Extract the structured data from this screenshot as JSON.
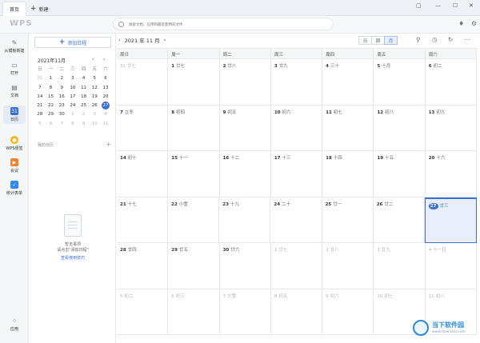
{
  "tabs": {
    "home": "首页",
    "new": "新建"
  },
  "header": {
    "logo": "WPS",
    "search_placeholder": "搜索文档、应用和最近使用的文件"
  },
  "leftnav": [
    {
      "label": "从模板新建",
      "icon": "new-doc-icon"
    },
    {
      "label": "打开",
      "icon": "folder-icon"
    },
    {
      "label": "文档",
      "icon": "document-icon"
    },
    {
      "label": "日历",
      "icon": "calendar-icon",
      "glyph": "31"
    },
    {
      "label": "WPS便签",
      "icon": "sticky-note-icon"
    },
    {
      "label": "会议",
      "icon": "meeting-icon"
    },
    {
      "label": "统计表单",
      "icon": "form-icon"
    },
    {
      "label": "应用",
      "icon": "apps-icon"
    }
  ],
  "side": {
    "add_label": "添加日程",
    "mini_title": "2021年11月",
    "weekdays": [
      "日",
      "一",
      "二",
      "三",
      "四",
      "五",
      "六"
    ],
    "weeks": [
      [
        "31",
        "1",
        "2",
        "3",
        "4",
        "5",
        "6"
      ],
      [
        "7",
        "8",
        "9",
        "10",
        "11",
        "12",
        "13"
      ],
      [
        "14",
        "15",
        "16",
        "17",
        "18",
        "19",
        "20"
      ],
      [
        "21",
        "22",
        "23",
        "24",
        "25",
        "26",
        "27"
      ],
      [
        "28",
        "29",
        "30",
        "1",
        "2",
        "3",
        "4"
      ],
      [
        "5",
        "6",
        "7",
        "8",
        "9",
        "10",
        "11"
      ]
    ],
    "my_calendars": "我的日历",
    "empty_title": "暂无事项",
    "empty_hint": "请点击\"添加日程\"",
    "empty_link": "查看使用技巧"
  },
  "toolbar": {
    "title": "2021 年 11 月",
    "prev": "‹",
    "next": "›",
    "views": [
      "日",
      "周",
      "月"
    ],
    "active_view": "月"
  },
  "calendar": {
    "headers": [
      "周日",
      "周一",
      "周二",
      "周三",
      "周四",
      "周五",
      "周六"
    ],
    "rows": [
      [
        {
          "d": "31",
          "l": "廿七",
          "o": true
        },
        {
          "d": "1",
          "l": "廿七"
        },
        {
          "d": "2",
          "l": "廿八"
        },
        {
          "d": "3",
          "l": "廿九"
        },
        {
          "d": "4",
          "l": "三十"
        },
        {
          "d": "5",
          "l": "十月"
        },
        {
          "d": "6",
          "l": "初二"
        }
      ],
      [
        {
          "d": "7",
          "l": "立冬"
        },
        {
          "d": "8",
          "l": "初四"
        },
        {
          "d": "9",
          "l": "初五"
        },
        {
          "d": "10",
          "l": "初六"
        },
        {
          "d": "11",
          "l": "初七"
        },
        {
          "d": "12",
          "l": "初八"
        },
        {
          "d": "13",
          "l": "初九"
        }
      ],
      [
        {
          "d": "14",
          "l": "初十"
        },
        {
          "d": "15",
          "l": "十一"
        },
        {
          "d": "16",
          "l": "十二"
        },
        {
          "d": "17",
          "l": "十三"
        },
        {
          "d": "18",
          "l": "十四"
        },
        {
          "d": "19",
          "l": "十五"
        },
        {
          "d": "20",
          "l": "十六"
        }
      ],
      [
        {
          "d": "21",
          "l": "十七"
        },
        {
          "d": "22",
          "l": "小雪"
        },
        {
          "d": "23",
          "l": "十九"
        },
        {
          "d": "24",
          "l": "二十"
        },
        {
          "d": "25",
          "l": "廿一"
        },
        {
          "d": "26",
          "l": "廿二"
        },
        {
          "d": "27",
          "l": "廿三",
          "today": true
        }
      ],
      [
        {
          "d": "28",
          "l": "廿四"
        },
        {
          "d": "29",
          "l": "廿五"
        },
        {
          "d": "30",
          "l": "廿六"
        },
        {
          "d": "1",
          "l": "廿七",
          "o": true
        },
        {
          "d": "2",
          "l": "廿八",
          "o": true
        },
        {
          "d": "3",
          "l": "廿九",
          "o": true
        },
        {
          "d": "4",
          "l": "十一月",
          "o": true
        }
      ],
      [
        {
          "d": "5",
          "l": "初二",
          "o": true
        },
        {
          "d": "6",
          "l": "初三",
          "o": true
        },
        {
          "d": "7",
          "l": "大雪",
          "o": true
        },
        {
          "d": "8",
          "l": "初五",
          "o": true
        },
        {
          "d": "9",
          "l": "初六",
          "o": true
        },
        {
          "d": "10",
          "l": "初七",
          "o": true
        },
        {
          "d": "11",
          "l": "初八",
          "o": true
        }
      ]
    ]
  },
  "watermark": {
    "title": "当下软件园",
    "url": "www.downxia.com"
  }
}
